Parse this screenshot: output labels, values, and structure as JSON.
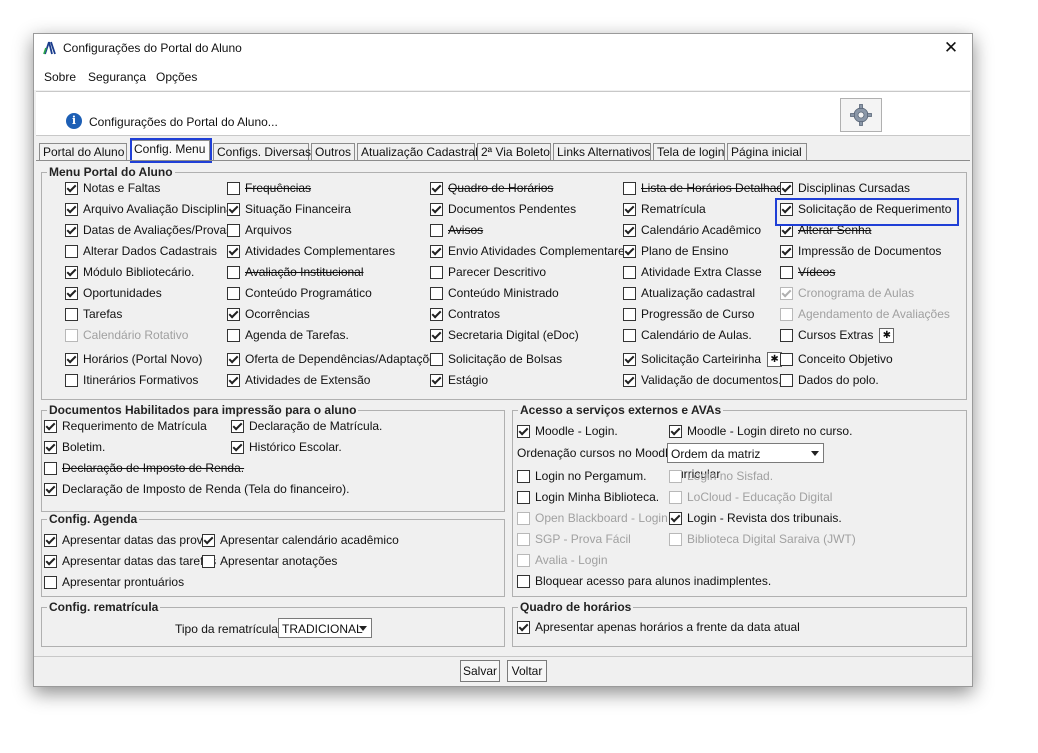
{
  "window": {
    "title": "Configurações do Portal do Aluno",
    "close_glyph": "✕"
  },
  "menubar": {
    "items": [
      "Sobre",
      "Segurança",
      "Opções"
    ]
  },
  "banner": {
    "text": "Configurações do Portal do Aluno...",
    "info_icon": "info-icon",
    "settings_icon": "gear-icon"
  },
  "tabs": [
    "Portal do Aluno",
    "Config. Menu",
    "Configs. Diversas",
    "Outros",
    "Atualização Cadastral",
    "2ª Via Boleto",
    "Links Alternativos",
    "Tela de login",
    "Página inicial"
  ],
  "active_tab": "Config. Menu",
  "menu_portal": {
    "title": "Menu Portal do Aluno",
    "items": [
      {
        "label": "Notas e Faltas",
        "checked": true
      },
      {
        "label": "Frequências",
        "checked": false,
        "strike": true
      },
      {
        "label": "Quadro de Horários",
        "checked": true,
        "strike": true
      },
      {
        "label": "Lista de Horários Detalhada",
        "checked": false,
        "strike": true
      },
      {
        "label": "Disciplinas Cursadas",
        "checked": true
      },
      {
        "label": "Arquivo Avaliação Disciplina",
        "checked": true
      },
      {
        "label": "Situação Financeira",
        "checked": true
      },
      {
        "label": "Documentos Pendentes",
        "checked": true
      },
      {
        "label": "Rematrícula",
        "checked": true
      },
      {
        "label": "Solicitação de Requerimento",
        "checked": true
      },
      {
        "label": "Datas de Avaliações/Provas",
        "checked": true
      },
      {
        "label": "Arquivos",
        "checked": false
      },
      {
        "label": "Avisos",
        "checked": false,
        "strike": true
      },
      {
        "label": "Calendário Acadêmico",
        "checked": true
      },
      {
        "label": "Alterar Senha",
        "checked": true,
        "strike": true
      },
      {
        "label": "Alterar Dados Cadastrais",
        "checked": false
      },
      {
        "label": "Atividades Complementares",
        "checked": true
      },
      {
        "label": "Envio Atividades Complementares",
        "checked": true
      },
      {
        "label": "Plano de Ensino",
        "checked": true
      },
      {
        "label": "Impressão de Documentos",
        "checked": true
      },
      {
        "label": "Módulo Bibliotecário.",
        "checked": true
      },
      {
        "label": "Avaliação Institucional",
        "checked": false,
        "strike": true
      },
      {
        "label": "Parecer Descritivo",
        "checked": false
      },
      {
        "label": "Atividade Extra Classe",
        "checked": false
      },
      {
        "label": "Vídeos",
        "checked": false,
        "strike": true
      },
      {
        "label": "Oportunidades",
        "checked": true
      },
      {
        "label": "Conteúdo Programático",
        "checked": false
      },
      {
        "label": "Conteúdo Ministrado",
        "checked": false
      },
      {
        "label": "Atualização cadastral",
        "checked": false
      },
      {
        "label": "Cronograma de Aulas",
        "checked": true,
        "disabled": true
      },
      {
        "label": "Tarefas",
        "checked": false
      },
      {
        "label": "Ocorrências",
        "checked": true
      },
      {
        "label": "Contratos",
        "checked": true
      },
      {
        "label": "Progressão de Curso",
        "checked": false
      },
      {
        "label": "Agendamento de Avaliações",
        "checked": false,
        "disabled": true
      },
      {
        "label": "Calendário Rotativo",
        "checked": false,
        "disabled": true
      },
      {
        "label": "Agenda de Tarefas.",
        "checked": false
      },
      {
        "label": "Secretaria Digital (eDoc)",
        "checked": true
      },
      {
        "label": "Calendário de Aulas.",
        "checked": false
      },
      {
        "label": "Cursos Extras",
        "checked": false,
        "gear": true
      },
      {
        "label": "Horários (Portal Novo)",
        "checked": true
      },
      {
        "label": "Oferta de Dependências/Adaptações",
        "checked": true
      },
      {
        "label": "Solicitação de Bolsas",
        "checked": false
      },
      {
        "label": "Solicitação Carteirinha",
        "checked": true,
        "gear": true
      },
      {
        "label": "Conceito Objetivo",
        "checked": false
      },
      {
        "label": "Itinerários Formativos",
        "checked": false
      },
      {
        "label": "Atividades de Extensão",
        "checked": true
      },
      {
        "label": "Estágio",
        "checked": true
      },
      {
        "label": "Validação de documentos.",
        "checked": true
      },
      {
        "label": "Dados do polo.",
        "checked": false
      }
    ]
  },
  "documentos": {
    "title": "Documentos Habilitados para impressão para o aluno",
    "items": [
      {
        "label": "Requerimento de Matrícula",
        "checked": true
      },
      {
        "label": "Declaração de Matrícula.",
        "checked": true
      },
      {
        "label": "Boletim.",
        "checked": true
      },
      {
        "label": "Histórico Escolar.",
        "checked": true
      },
      {
        "label": "Declaração de Imposto de Renda.",
        "checked": false,
        "strike": true
      },
      {
        "label": "Declaração de Imposto de Renda (Tela do financeiro).",
        "checked": true
      }
    ]
  },
  "agenda": {
    "title": "Config. Agenda",
    "items": [
      {
        "label": "Apresentar datas das provas",
        "checked": true
      },
      {
        "label": "Apresentar calendário acadêmico",
        "checked": true
      },
      {
        "label": "Apresentar datas das tarefas",
        "checked": true
      },
      {
        "label": "Apresentar anotações",
        "checked": false
      },
      {
        "label": "Apresentar prontuários",
        "checked": false
      }
    ]
  },
  "rematricula": {
    "title": "Config. rematrícula",
    "label": "Tipo da rematrícula:",
    "value": "TRADICIONAL"
  },
  "externos": {
    "title": "Acesso a serviços externos e AVAs",
    "moodle_login": {
      "label": "Moodle - Login.",
      "checked": true
    },
    "moodle_direto": {
      "label": "Moodle - Login direto no curso.",
      "checked": true
    },
    "ordenacao_label": "Ordenação cursos no Moodle:",
    "ordenacao_value": "Ordem da matriz curricular",
    "items": [
      {
        "label": "Login no Pergamum.",
        "checked": false
      },
      {
        "label": "Login no Sisfad.",
        "checked": false,
        "disabled": true
      },
      {
        "label": "Login Minha Biblioteca.",
        "checked": false
      },
      {
        "label": "LoCloud - Educação Digital",
        "checked": false,
        "disabled": true
      },
      {
        "label": "Open Blackboard - Login",
        "checked": false,
        "disabled": true
      },
      {
        "label": "Login - Revista dos tribunais.",
        "checked": true
      },
      {
        "label": "SGP - Prova Fácil",
        "checked": false,
        "disabled": true
      },
      {
        "label": "Biblioteca Digital Saraiva (JWT)",
        "checked": false,
        "disabled": true
      },
      {
        "label": "Avalia - Login",
        "checked": false,
        "disabled": true
      },
      {
        "label": "Bloquear acesso para alunos inadimplentes.",
        "checked": false
      }
    ]
  },
  "quadro": {
    "title": "Quadro de horários",
    "item": {
      "label": "Apresentar apenas horários a frente da data atual",
      "checked": true
    }
  },
  "footer": {
    "save": "Salvar",
    "back": "Voltar"
  }
}
